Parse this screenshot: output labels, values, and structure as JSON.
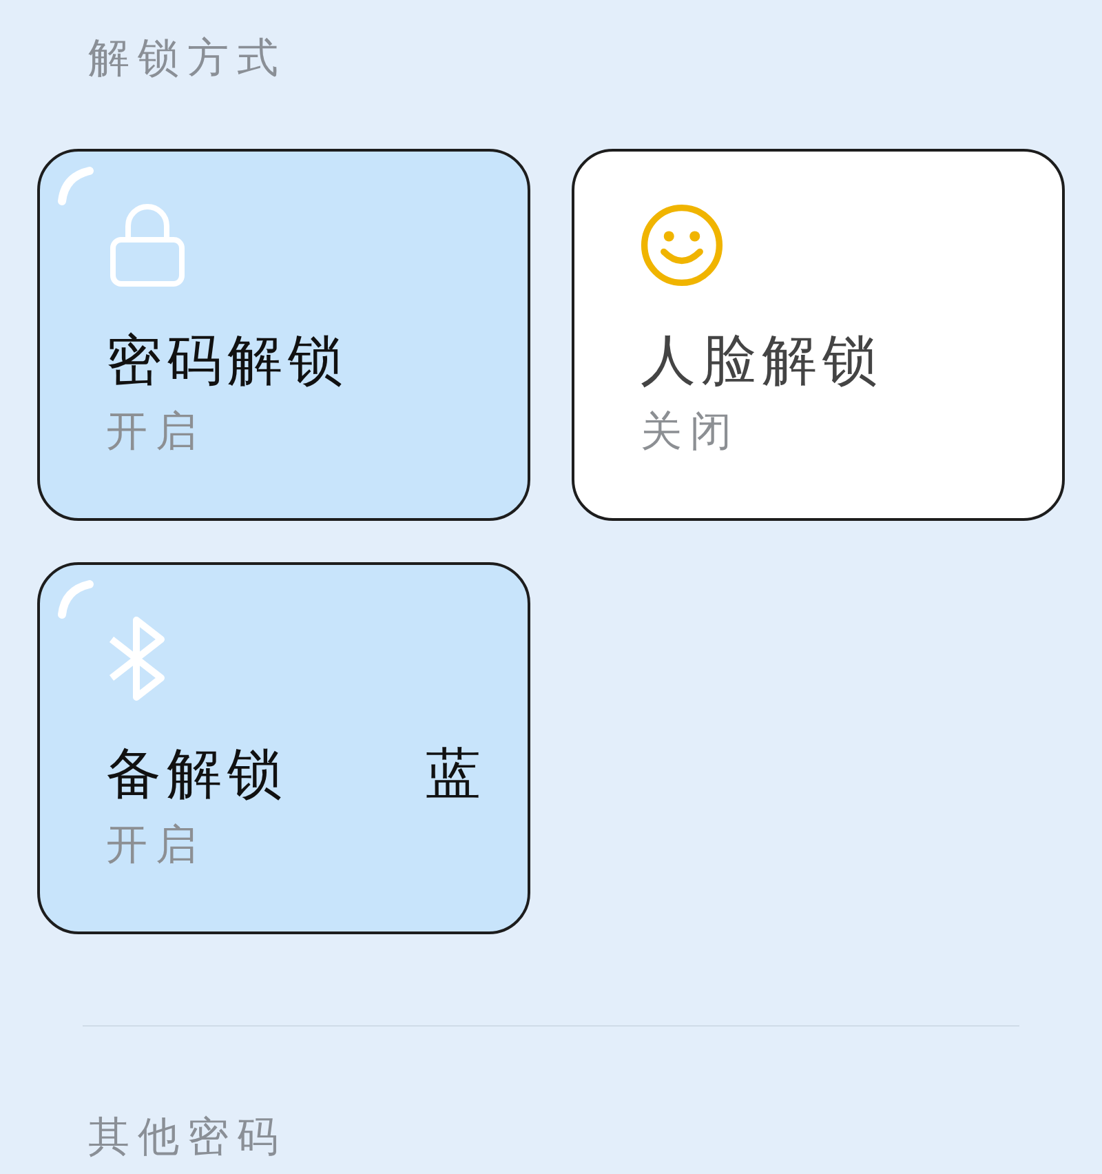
{
  "section_title": "解锁方式",
  "cards": [
    {
      "kind": "lock",
      "title_parts": [
        "密码解锁"
      ],
      "status": "开启",
      "on": true
    },
    {
      "kind": "face",
      "title_parts": [
        "人脸解锁"
      ],
      "status": "关闭",
      "on": false
    },
    {
      "kind": "bluetooth",
      "title_parts": [
        "备解锁",
        "蓝"
      ],
      "status": "开启",
      "on": true
    }
  ],
  "next_section_title": "其他密码"
}
